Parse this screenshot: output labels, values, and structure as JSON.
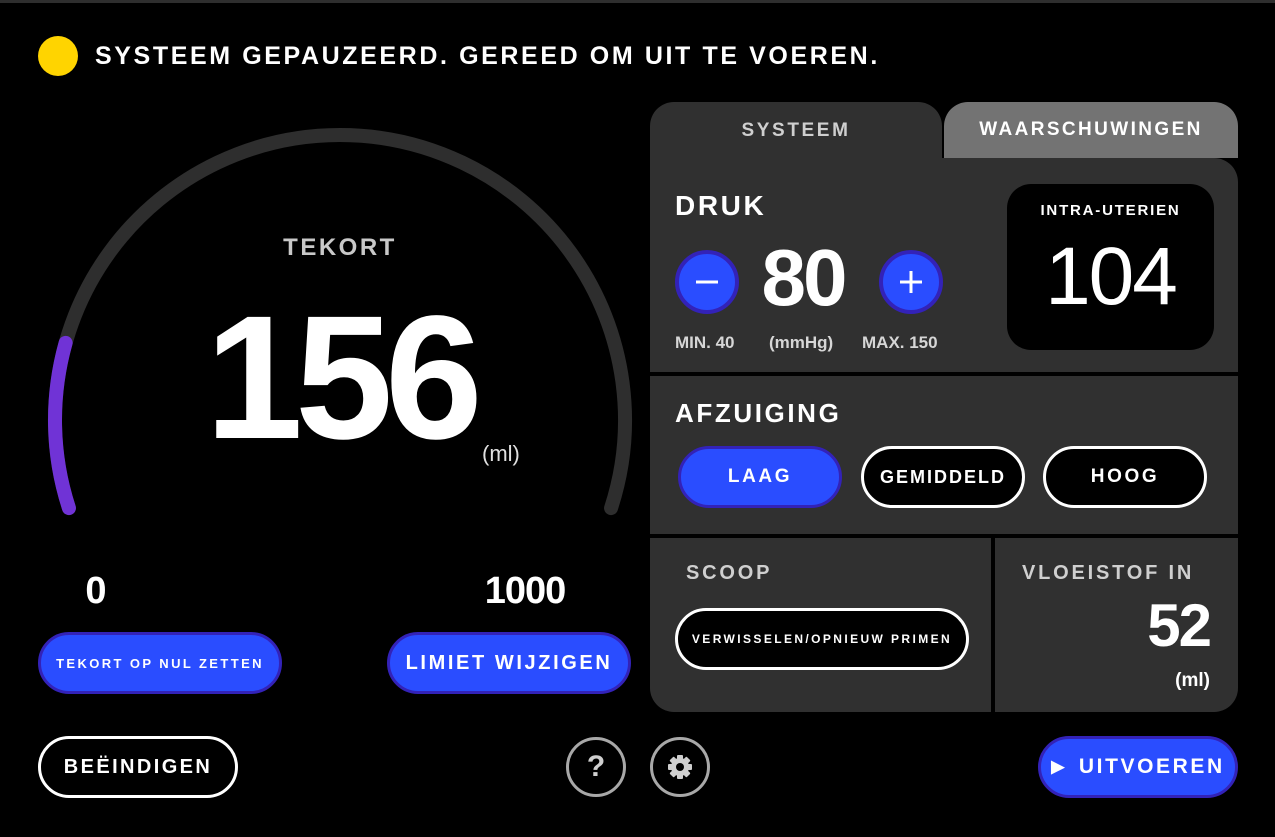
{
  "status": {
    "text": "SYSTEEM GEPAUZEERD. GEREED OM UIT TE VOEREN.",
    "indicator_color": "#ffd400"
  },
  "deficit": {
    "label": "TEKORT",
    "value": "156",
    "unit": "(ml)",
    "scale_min": "0",
    "scale_max": "1000",
    "gauge_fraction": 0.156,
    "track_color": "#2e2e2e",
    "fill_color_start": "#7033d6",
    "fill_color_end": "#5b3cf2",
    "reset_button": "TEKORT OP NUL ZETTEN",
    "limit_button": "LIMIET WIJZIGEN"
  },
  "tabs": {
    "system": "SYSTEEM",
    "warnings": "WAARSCHUWINGEN"
  },
  "pressure": {
    "title": "DRUK",
    "value": "80",
    "min_label": "MIN. 40",
    "unit_label": "(mmHg)",
    "max_label": "MAX. 150",
    "decrease_icon": "minus-icon",
    "increase_icon": "plus-icon",
    "intrauterine_label": "INTRA-UTERIEN",
    "intrauterine_value": "104"
  },
  "suction": {
    "title": "AFZUIGING",
    "options": [
      "LAAG",
      "GEMIDDELD",
      "HOOG"
    ],
    "selected": "LAAG"
  },
  "scope": {
    "title": "SCOOP",
    "button": "VERWISSELEN/OPNIEUW PRIMEN"
  },
  "fluid_in": {
    "title": "VLOEISTOF IN",
    "value": "52",
    "unit": "(ml)"
  },
  "footer": {
    "end_button": "BEËINDIGEN",
    "help_icon": "help-icon",
    "settings_icon": "gear-icon",
    "run_icon": "play-icon",
    "run_button": "UITVOEREN"
  },
  "colors": {
    "accent": "#2a4dff",
    "accent_border": "#3322b8",
    "panel": "#303030",
    "warning_tab": "#737373"
  }
}
